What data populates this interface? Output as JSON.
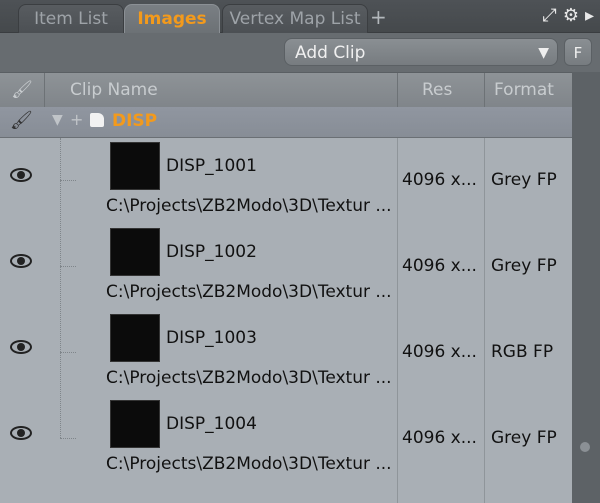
{
  "tabs": [
    {
      "label": "Item List",
      "active": false
    },
    {
      "label": "Images",
      "active": true
    },
    {
      "label": "Vertex Map List",
      "active": false
    }
  ],
  "toolbar": {
    "add_clip_label": "Add Clip",
    "f_label": "F"
  },
  "header": {
    "clip_name": "Clip Name",
    "res": "Res",
    "format": "Format"
  },
  "group": {
    "name": "DISP"
  },
  "clips": [
    {
      "name": "DISP_1001",
      "path": "C:\\Projects\\ZB2Modo\\3D\\Textur ...",
      "res": "4096 x...",
      "format": "Grey FP"
    },
    {
      "name": "DISP_1002",
      "path": "C:\\Projects\\ZB2Modo\\3D\\Textur ...",
      "res": "4096 x...",
      "format": "Grey FP"
    },
    {
      "name": "DISP_1003",
      "path": "C:\\Projects\\ZB2Modo\\3D\\Textur ...",
      "res": "4096 x...",
      "format": "RGB FP"
    },
    {
      "name": "DISP_1004",
      "path": "C:\\Projects\\ZB2Modo\\3D\\Textur ...",
      "res": "4096 x...",
      "format": "Grey FP"
    }
  ],
  "colors": {
    "accent": "#f39a1c",
    "panel": "#676c70",
    "list_bg": "#a9afb5"
  }
}
